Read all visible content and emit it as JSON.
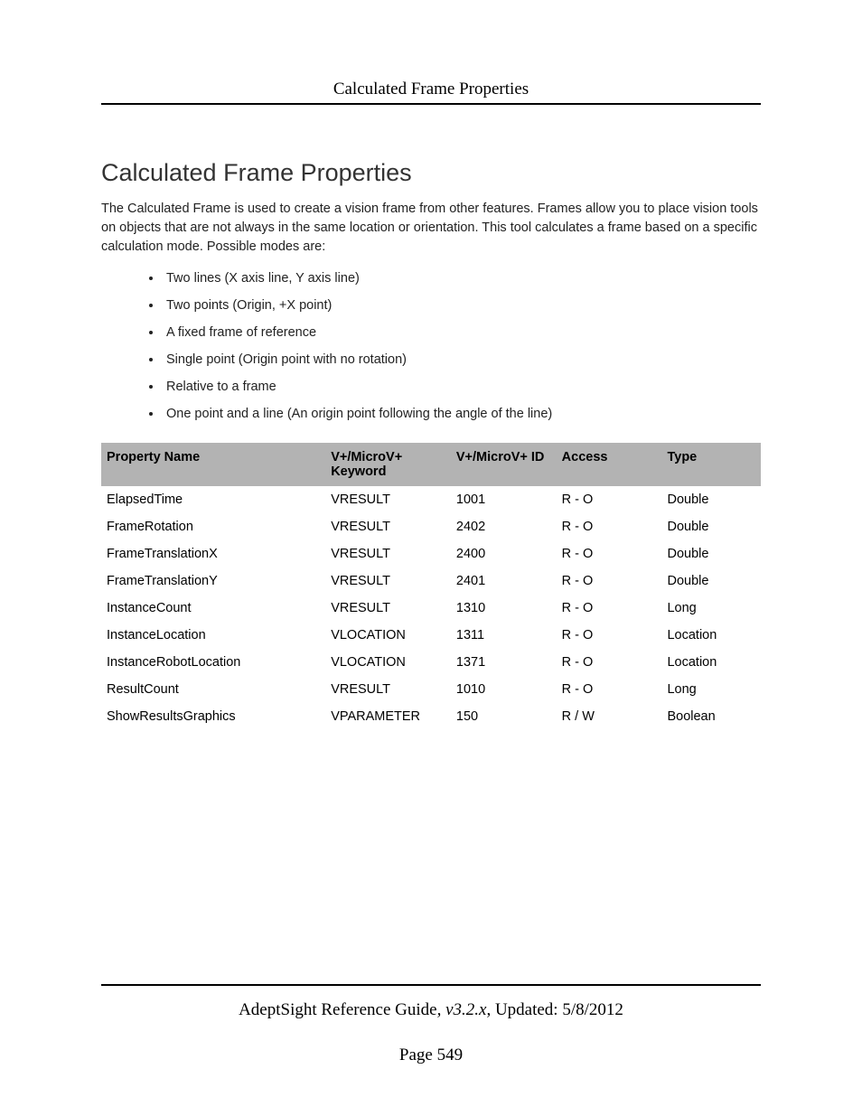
{
  "header": {
    "running_title": "Calculated Frame Properties"
  },
  "title": "Calculated Frame Properties",
  "intro": "The Calculated Frame is used to create a vision frame from other features. Frames allow you to place vision tools on objects that are not always in the same location or orientation. This tool calculates a frame based on a specific calculation mode. Possible modes are:",
  "modes": [
    "Two lines (X axis line, Y axis line)",
    "Two points (Origin, +X point)",
    "A fixed frame of reference",
    "Single point (Origin point with no rotation)",
    "Relative to a frame",
    "One point and a line (An origin point following the angle of the line)"
  ],
  "table": {
    "headers": {
      "name": "Property Name",
      "keyword": "V+/MicroV+ Keyword",
      "id": "V+/MicroV+ ID",
      "access": "Access",
      "type": "Type"
    },
    "rows": [
      {
        "name": "ElapsedTime",
        "keyword": "VRESULT",
        "id": "1001",
        "access": "R - O",
        "type": "Double",
        "link": false
      },
      {
        "name": "FrameRotation",
        "keyword": "VRESULT",
        "id": "2402",
        "access": "R - O",
        "type": "Double",
        "link": false
      },
      {
        "name": "FrameTranslationX",
        "keyword": "VRESULT",
        "id": "2400",
        "access": "R - O",
        "type": "Double",
        "link": false
      },
      {
        "name": "FrameTranslationY",
        "keyword": "VRESULT",
        "id": "2401",
        "access": "R - O",
        "type": "Double",
        "link": false
      },
      {
        "name": "InstanceCount",
        "keyword": "VRESULT",
        "id": "1310",
        "access": "R - O",
        "type": "Long",
        "link": false
      },
      {
        "name": "InstanceLocation",
        "keyword": "VLOCATION",
        "id": "1311",
        "access": "R - O",
        "type": "Location",
        "link": true
      },
      {
        "name": "InstanceRobotLocation",
        "keyword": "VLOCATION",
        "id": "1371",
        "access": "R - O",
        "type": "Location",
        "link": false
      },
      {
        "name": "ResultCount",
        "keyword": "VRESULT",
        "id": "1010",
        "access": "R - O",
        "type": "Long",
        "link": false
      },
      {
        "name": "ShowResultsGraphics",
        "keyword": "VPARAMETER",
        "id": "150",
        "access": "R / W",
        "type": "Boolean",
        "link": false
      }
    ]
  },
  "footer": {
    "guide": "AdeptSight Reference Guide",
    "version_prefix": ", ",
    "version": "v3.2.x",
    "updated_prefix": ", Updated: ",
    "updated": "5/8/2012",
    "page_label": "Page 549"
  }
}
